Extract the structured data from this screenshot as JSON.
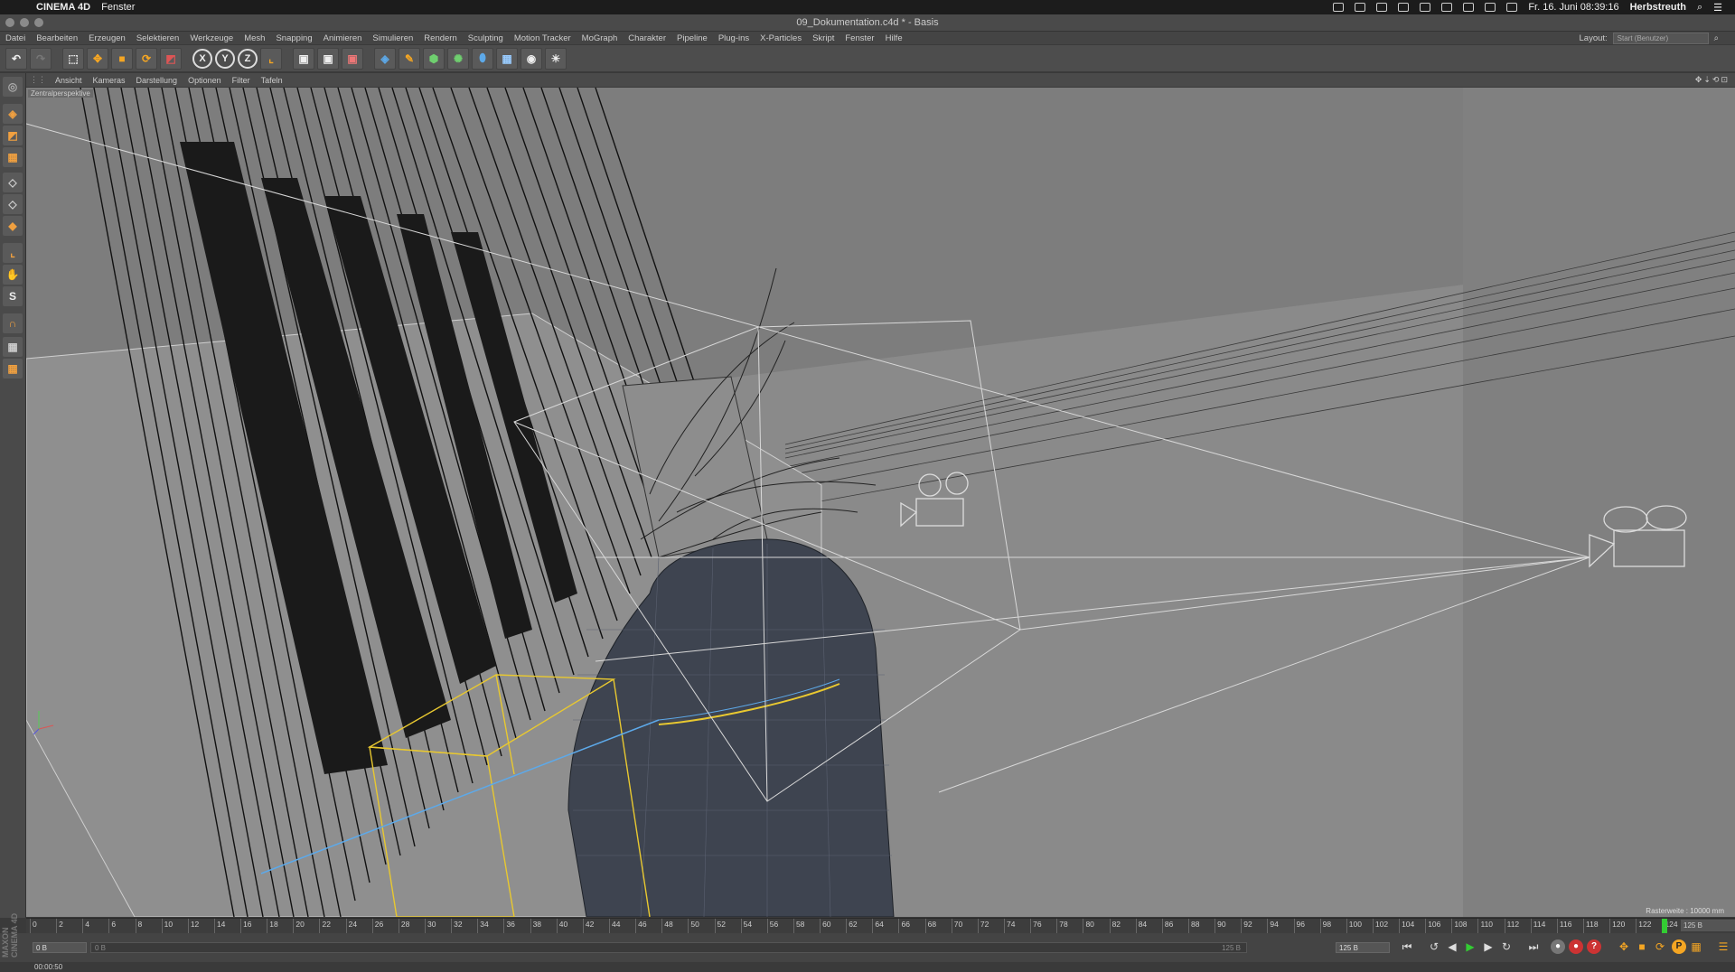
{
  "macbar": {
    "app_name": "CINEMA 4D",
    "menu": "Fenster",
    "clock": "Fr. 16. Juni  08:39:16",
    "user": "Herbstreuth"
  },
  "window": {
    "title": "09_Dokumentation.c4d * - Basis"
  },
  "app_menu": {
    "items": [
      "Datei",
      "Bearbeiten",
      "Erzeugen",
      "Selektieren",
      "Werkzeuge",
      "Mesh",
      "Snapping",
      "Animieren",
      "Simulieren",
      "Rendern",
      "Sculpting",
      "Motion Tracker",
      "MoGraph",
      "Charakter",
      "Pipeline",
      "Plug-ins",
      "X-Particles",
      "Skript",
      "Fenster",
      "Hilfe"
    ],
    "layout_label": "Layout:",
    "layout_value": "Start (Benutzer)"
  },
  "toolbar": {
    "axis_x": "X",
    "axis_y": "Y",
    "axis_z": "Z"
  },
  "viewport_menu": {
    "items": [
      "Ansicht",
      "Kameras",
      "Darstellung",
      "Optionen",
      "Filter",
      "Tafeln"
    ],
    "nav_icons": "✥⇣⟲⊡"
  },
  "viewport": {
    "camera_label": "Zentralperspektive",
    "grid_info": "Rasterweite : 10000 mm"
  },
  "timeline": {
    "ticks": [
      "0",
      "2",
      "4",
      "6",
      "8",
      "10",
      "12",
      "14",
      "16",
      "18",
      "20",
      "22",
      "24",
      "26",
      "28",
      "30",
      "32",
      "34",
      "36",
      "38",
      "40",
      "42",
      "44",
      "46",
      "48",
      "50",
      "52",
      "54",
      "56",
      "58",
      "60",
      "62",
      "64",
      "66",
      "68",
      "70",
      "72",
      "74",
      "76",
      "78",
      "80",
      "82",
      "84",
      "86",
      "88",
      "90",
      "92",
      "94",
      "96",
      "98",
      "100",
      "102",
      "104",
      "106",
      "108",
      "110",
      "112",
      "114",
      "116",
      "118",
      "120",
      "122",
      "124"
    ],
    "end_frame": "125 B",
    "current_frame": 124,
    "max_frame": 125
  },
  "transport": {
    "start_field": "0 B",
    "range_start": "0 B",
    "range_end": "125 B",
    "end_field": "125 B"
  },
  "status": {
    "time": "00:00:50"
  },
  "brand": "MAXON CINEMA 4D",
  "colors": {
    "viewport_bg": "#7d7d7d",
    "selection_yellow": "#e8c830",
    "camera_wire": "#d8d8d8",
    "mesh_dark": "#3e4450"
  }
}
